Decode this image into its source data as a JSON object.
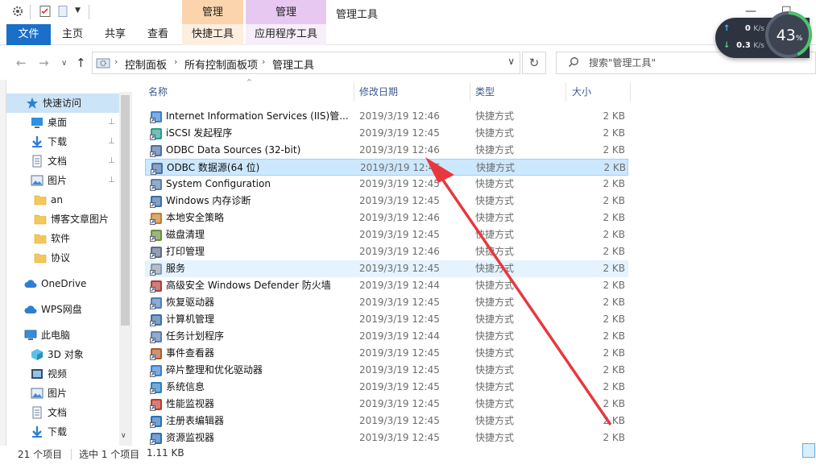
{
  "window": {
    "title": "管理工具",
    "context_tabs": [
      "管理",
      "管理"
    ],
    "minimize": "—",
    "maximize": "☐"
  },
  "ribbon": {
    "tabs": [
      "文件",
      "主页",
      "共享",
      "查看",
      "快捷工具",
      "应用程序工具"
    ]
  },
  "address": {
    "crumbs": [
      "控制面板",
      "所有控制面板项",
      "管理工具"
    ],
    "separator": "›",
    "back": "←",
    "forward": "→",
    "up": "↑",
    "dropdown": "∨",
    "refresh": "↻"
  },
  "search": {
    "placeholder": "搜索\"管理工具\""
  },
  "speed_widget": {
    "upload": "0",
    "upload_unit": "K/s",
    "download": "0.3",
    "download_unit": "K/s",
    "cpu_percent": "43",
    "cpu_unit": "%"
  },
  "nav": {
    "items": [
      {
        "label": "快速访问",
        "icon": "star-icon",
        "pinned": false,
        "selected": true
      },
      {
        "label": "桌面",
        "icon": "desktop-icon",
        "pinned": true
      },
      {
        "label": "下载",
        "icon": "download-icon",
        "pinned": true
      },
      {
        "label": "文档",
        "icon": "document-icon",
        "pinned": true
      },
      {
        "label": "图片",
        "icon": "picture-icon",
        "pinned": true
      },
      {
        "label": "an",
        "icon": "folder-icon"
      },
      {
        "label": "博客文章图片",
        "icon": "folder-icon"
      },
      {
        "label": "软件",
        "icon": "folder-icon"
      },
      {
        "label": "协议",
        "icon": "folder-icon"
      },
      {
        "label": "OneDrive",
        "icon": "cloud-icon"
      },
      {
        "label": "WPS网盘",
        "icon": "cloud-icon"
      },
      {
        "label": "此电脑",
        "icon": "computer-icon"
      },
      {
        "label": "3D 对象",
        "icon": "cube-icon"
      },
      {
        "label": "视频",
        "icon": "video-icon"
      },
      {
        "label": "图片",
        "icon": "picture-icon"
      },
      {
        "label": "文档",
        "icon": "document-icon"
      },
      {
        "label": "下载",
        "icon": "download-icon"
      }
    ],
    "pin_glyph": "📌"
  },
  "columns": {
    "name": "名称",
    "date": "修改日期",
    "type": "类型",
    "size": "大小"
  },
  "files": [
    {
      "name": "Internet Information Services (IIS)管...",
      "date": "2019/3/19 12:46",
      "type": "快捷方式",
      "size": "2 KB"
    },
    {
      "name": "iSCSI 发起程序",
      "date": "2019/3/19 12:45",
      "type": "快捷方式",
      "size": "2 KB"
    },
    {
      "name": "ODBC Data Sources (32-bit)",
      "date": "2019/3/19 12:46",
      "type": "快捷方式",
      "size": "2 KB"
    },
    {
      "name": "ODBC 数据源(64 位)",
      "date": "2019/3/19 12:45",
      "type": "快捷方式",
      "size": "2 KB",
      "selected": true
    },
    {
      "name": "System Configuration",
      "date": "2019/3/19 12:45",
      "type": "快捷方式",
      "size": "2 KB"
    },
    {
      "name": "Windows 内存诊断",
      "date": "2019/3/19 12:45",
      "type": "快捷方式",
      "size": "2 KB"
    },
    {
      "name": "本地安全策略",
      "date": "2019/3/19 12:46",
      "type": "快捷方式",
      "size": "2 KB"
    },
    {
      "name": "磁盘清理",
      "date": "2019/3/19 12:45",
      "type": "快捷方式",
      "size": "2 KB"
    },
    {
      "name": "打印管理",
      "date": "2019/3/19 12:46",
      "type": "快捷方式",
      "size": "2 KB"
    },
    {
      "name": "服务",
      "date": "2019/3/19 12:45",
      "type": "快捷方式",
      "size": "2 KB",
      "hover": true
    },
    {
      "name": "高级安全 Windows Defender 防火墙",
      "date": "2019/3/19 12:44",
      "type": "快捷方式",
      "size": "2 KB"
    },
    {
      "name": "恢复驱动器",
      "date": "2019/3/19 12:45",
      "type": "快捷方式",
      "size": "2 KB"
    },
    {
      "name": "计算机管理",
      "date": "2019/3/19 12:45",
      "type": "快捷方式",
      "size": "2 KB"
    },
    {
      "name": "任务计划程序",
      "date": "2019/3/19 12:44",
      "type": "快捷方式",
      "size": "2 KB"
    },
    {
      "name": "事件查看器",
      "date": "2019/3/19 12:45",
      "type": "快捷方式",
      "size": "2 KB"
    },
    {
      "name": "碎片整理和优化驱动器",
      "date": "2019/3/19 12:45",
      "type": "快捷方式",
      "size": "2 KB"
    },
    {
      "name": "系统信息",
      "date": "2019/3/19 12:45",
      "type": "快捷方式",
      "size": "2 KB"
    },
    {
      "name": "性能监视器",
      "date": "2019/3/19 12:45",
      "type": "快捷方式",
      "size": "2 KB"
    },
    {
      "name": "注册表编辑器",
      "date": "2019/3/19 12:45",
      "type": "快捷方式",
      "size": "2 KB"
    },
    {
      "name": "资源监视器",
      "date": "2019/3/19 12:45",
      "type": "快捷方式",
      "size": "2 KB"
    }
  ],
  "status": {
    "count": "21 个项目",
    "selected": "选中 1 个项目",
    "size": "1.11 KB"
  },
  "colors": {
    "accent": "#1a6fc8",
    "selection": "#cce8ff",
    "annotation_arrow": "#e8383d"
  }
}
